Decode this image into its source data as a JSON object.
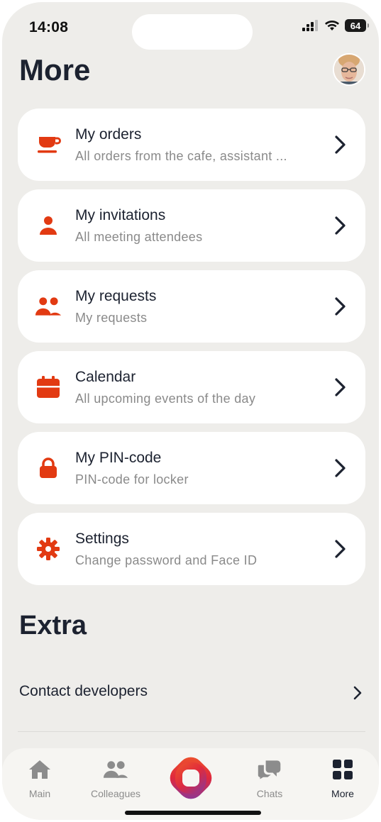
{
  "status_bar": {
    "time": "14:08",
    "battery": "64"
  },
  "header": {
    "title": "More"
  },
  "menu": [
    {
      "title": "My orders",
      "subtitle": "All orders from the cafe, assistant ...",
      "icon": "cup-icon"
    },
    {
      "title": "My invitations",
      "subtitle": "All meeting attendees",
      "icon": "person-icon"
    },
    {
      "title": "My requests",
      "subtitle": "My requests",
      "icon": "people-icon"
    },
    {
      "title": "Calendar",
      "subtitle": "All upcoming events of the day",
      "icon": "calendar-icon"
    },
    {
      "title": "My PIN-code",
      "subtitle": "PIN-code for locker",
      "icon": "lock-icon"
    },
    {
      "title": "Settings",
      "subtitle": "Change password and Face ID",
      "icon": "gear-icon"
    }
  ],
  "extra": {
    "title": "Extra",
    "contact_label": "Contact developers"
  },
  "tabs": [
    {
      "label": "Main",
      "icon": "home-icon"
    },
    {
      "label": "Colleagues",
      "icon": "people-icon"
    },
    {
      "label": "",
      "icon": "app-logo"
    },
    {
      "label": "Chats",
      "icon": "chat-icon"
    },
    {
      "label": "More",
      "icon": "grid-icon",
      "active": true
    }
  ],
  "colors": {
    "accent": "#e23a12",
    "background": "#eeedea",
    "card": "#ffffff",
    "text": "#1c2230",
    "muted": "#8a8a8a"
  }
}
